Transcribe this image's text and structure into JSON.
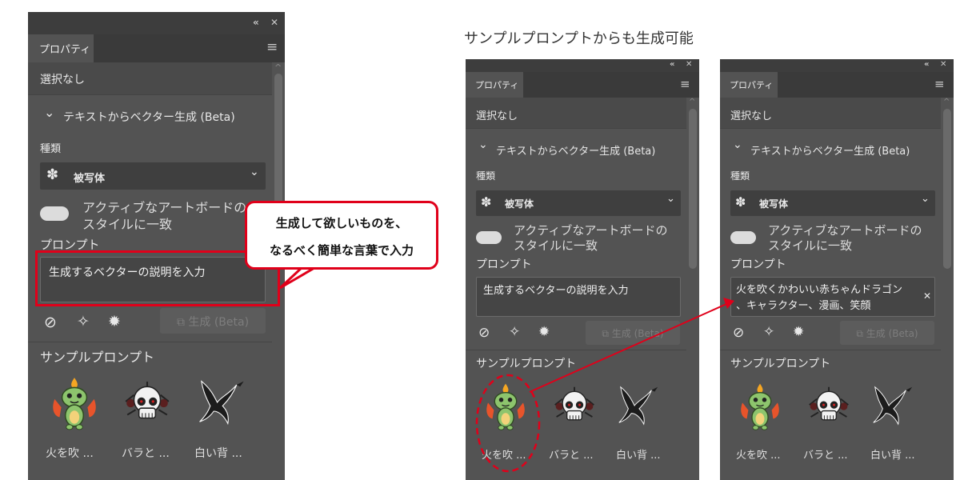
{
  "heading": "サンプルプロンプトからも生成可能",
  "callout": {
    "line1": "生成して欲しいものを、",
    "line2": "なるべく簡単な言葉で入力"
  },
  "panel": {
    "collapse_glyph": "«",
    "close_glyph": "✕",
    "tab_label": "プロパティ",
    "menu_glyph": "≡",
    "selection": "選択なし",
    "section_chevron": "⌄",
    "section_title": "テキストからベクター生成 (Beta)",
    "type_label": "種類",
    "type_icon": "subject-icon",
    "type_value": "被写体",
    "match_style_line1": "アクティブなアートボードの",
    "match_style_line2": "スタイルに一致",
    "prompt_label": "プロンプト",
    "prompt_placeholder": "生成するベクターの説明を入力",
    "generate_label": "生成 (Beta)",
    "samples_label": "サンプルプロンプト",
    "samples": [
      {
        "label": "火を吹 ...",
        "icon": "dragon-icon"
      },
      {
        "label": "バラと ...",
        "icon": "skull-icon"
      },
      {
        "label": "白い背 ...",
        "icon": "bird-icon"
      }
    ]
  },
  "panel3": {
    "prompt_line1": "火を吹くかわいい赤ちゃんドラゴン",
    "prompt_line2": "、キャラクター、漫画、笑顔",
    "clear_glyph": "✕"
  },
  "colors": {
    "panel_bg": "#535353",
    "accent_red": "#e0001a"
  }
}
